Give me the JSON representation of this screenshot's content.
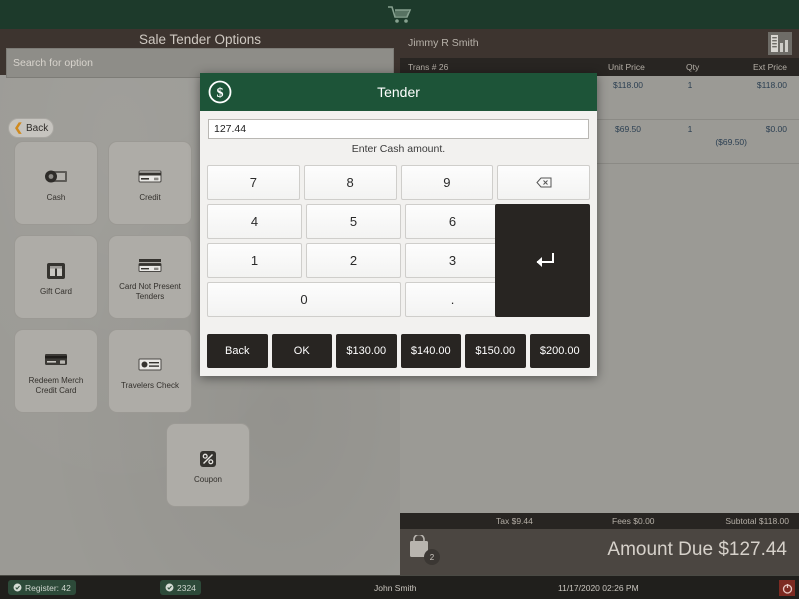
{
  "topbar": {
    "cart_icon": "shopping-cart-icon"
  },
  "left": {
    "title": "Sale Tender Options",
    "search_placeholder": "Search for option",
    "search_value": "",
    "back_label": "Back",
    "tiles": [
      {
        "label": "Cash",
        "icon": "cash-icon"
      },
      {
        "label": "Credit",
        "icon": "credit-card-icon"
      },
      {
        "label": "Gift Card",
        "icon": "gift-card-icon"
      },
      {
        "label": "Card Not Present Tenders",
        "icon": "credit-card-icon"
      },
      {
        "label": "Redeem Merch Credit Card",
        "icon": "credit-card-icon"
      },
      {
        "label": "Travelers Check",
        "icon": "check-icon"
      },
      {
        "label": "Coupon",
        "icon": "percent-icon"
      }
    ]
  },
  "right": {
    "customer_name": "Jimmy R Smith",
    "store_icon": "building-icon",
    "trans_label": "Trans # 26",
    "columns": {
      "unit": "Unit Price",
      "qty": "Qty",
      "ext": "Ext Price"
    },
    "items": [
      {
        "unit_price": "$118.00",
        "qty": "1",
        "ext_price": "$118.00",
        "discount": ""
      },
      {
        "unit_price": "$69.50",
        "qty": "1",
        "ext_price": "$0.00",
        "discount": "($69.50)"
      }
    ],
    "totals": {
      "tax": "Tax $9.44",
      "fees": "Fees $0.00",
      "subtotal": "Subtotal $118.00"
    },
    "amount_due_label": "Amount Due",
    "amount_due_value": "$127.44",
    "bag_count": "2"
  },
  "modal": {
    "title": "Tender",
    "icon": "dollar-circle-icon",
    "amount_value": "127.44",
    "hint": "Enter Cash amount.",
    "keys": {
      "row1": [
        "7",
        "8",
        "9"
      ],
      "row2": [
        "4",
        "5",
        "6"
      ],
      "row3": [
        "1",
        "2",
        "3"
      ],
      "row4": [
        "0",
        "."
      ],
      "backspace": "backspace-icon",
      "enter": "enter-icon"
    },
    "actions": [
      "Back",
      "OK",
      "$130.00",
      "$140.00",
      "$150.00",
      "$200.00"
    ]
  },
  "statusbar": {
    "register": "Register: 42",
    "code": "2324",
    "user": "John Smith",
    "datetime": "11/17/2020 02:26 PM",
    "power_icon": "power-icon"
  }
}
